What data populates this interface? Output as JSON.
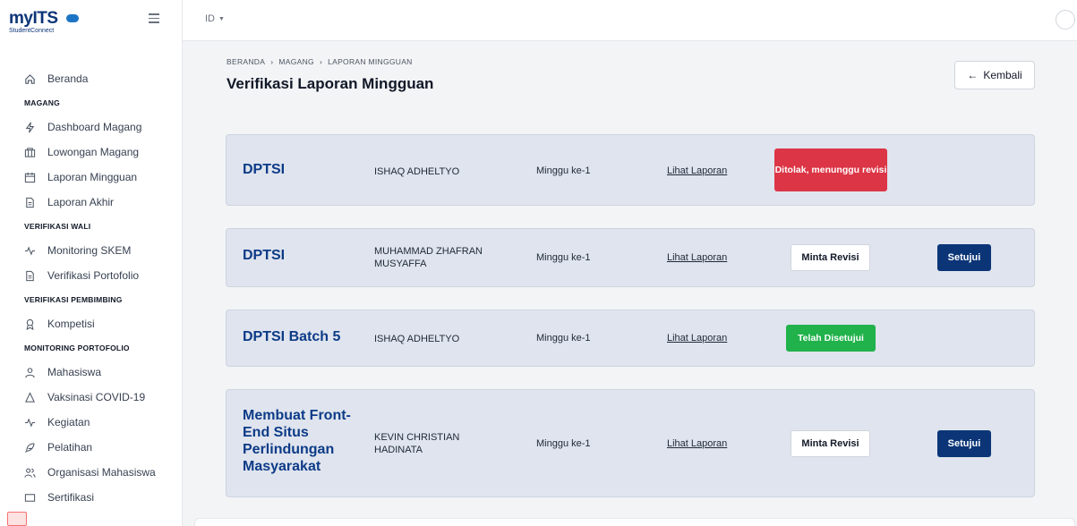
{
  "brand": {
    "logo_main": "myITS",
    "logo_sub": "StudentConnect"
  },
  "topbar": {
    "language": "ID"
  },
  "sidebar": {
    "items": [
      {
        "label": "Beranda",
        "icon": "home-icon"
      },
      {
        "section": "MAGANG"
      },
      {
        "label": "Dashboard Magang",
        "icon": "activity-icon"
      },
      {
        "label": "Lowongan Magang",
        "icon": "columns-icon"
      },
      {
        "label": "Laporan Mingguan",
        "icon": "calendar-icon"
      },
      {
        "label": "Laporan Akhir",
        "icon": "file-icon"
      },
      {
        "section": "VERIFIKASI WALI"
      },
      {
        "label": "Monitoring SKEM",
        "icon": "pulse-icon"
      },
      {
        "label": "Verifikasi Portofolio",
        "icon": "file-icon"
      },
      {
        "section": "VERIFIKASI PEMBIMBING"
      },
      {
        "label": "Kompetisi",
        "icon": "award-icon"
      },
      {
        "section": "MONITORING PORTOFOLIO"
      },
      {
        "label": "Mahasiswa",
        "icon": "user-icon"
      },
      {
        "label": "Vaksinasi COVID-19",
        "icon": "shield-icon"
      },
      {
        "label": "Kegiatan",
        "icon": "pulse-icon"
      },
      {
        "label": "Pelatihan",
        "icon": "feather-icon"
      },
      {
        "label": "Organisasi Mahasiswa",
        "icon": "users-icon"
      },
      {
        "label": "Sertifikasi",
        "icon": "certificate-icon"
      }
    ]
  },
  "breadcrumb": [
    "BERANDA",
    "›",
    "MAGANG",
    "›",
    "LAPORAN MINGGUAN"
  ],
  "page_title": "Verifikasi Laporan Mingguan",
  "back_button": "Kembali",
  "reports": [
    {
      "title": "DPTSI",
      "name": "ISHAQ ADHELTYO",
      "week": "Minggu ke-1",
      "link": "Lihat Laporan",
      "status": "Ditolak, menunggu revisi"
    },
    {
      "title": "DPTSI",
      "name": "MUHAMMAD ZHAFRAN MUSYAFFA",
      "week": "Minggu ke-1",
      "link": "Lihat Laporan",
      "revise_label": "Minta Revisi",
      "approve_label": "Setujui"
    },
    {
      "title": "DPTSI Batch 5",
      "name": "ISHAQ ADHELTYO",
      "week": "Minggu ke-1",
      "link": "Lihat Laporan",
      "status": "Telah Disetujui"
    },
    {
      "title": "Membuat Front-End Situs Perlindungan Masyarakat",
      "name": "KEVIN CHRISTIAN HADINATA",
      "week": "Minggu ke-1",
      "link": "Lihat Laporan",
      "revise_label": "Minta Revisi",
      "approve_label": "Setujui"
    }
  ],
  "colors": {
    "primary": "#0b3577",
    "danger": "#dc3545",
    "success": "#21b24b",
    "card_bg": "#dfe4ee"
  }
}
